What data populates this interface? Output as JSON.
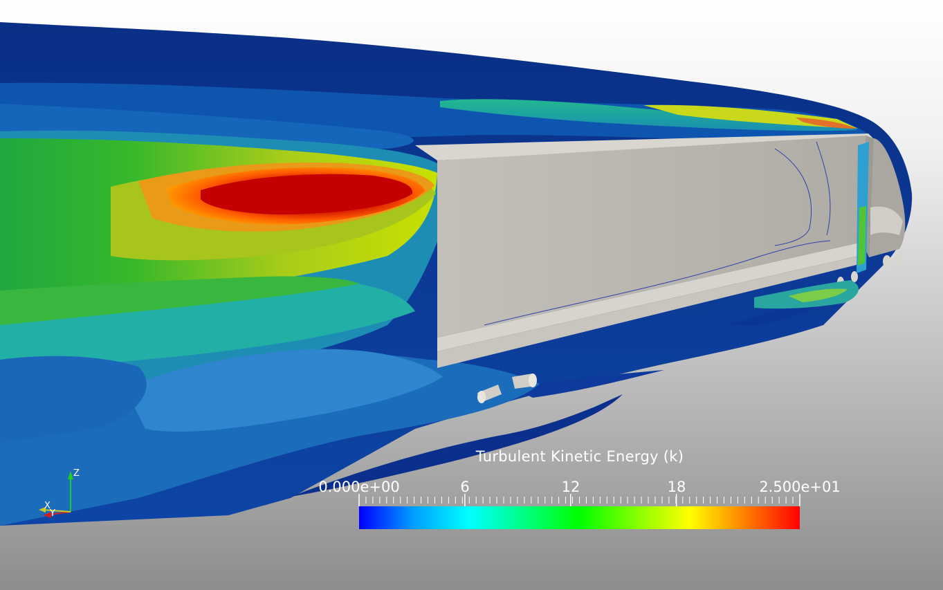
{
  "scalar_bar": {
    "title": "Turbulent Kinetic Energy (k)",
    "range": [
      0,
      25
    ],
    "labels": [
      "0.000e+00",
      "6",
      "12",
      "18",
      "2.500e+01"
    ],
    "label_values": [
      0,
      6,
      12,
      18,
      25
    ],
    "color_count": 64,
    "colormap": [
      "#0000ff",
      "#00a0ff",
      "#00ffff",
      "#00ff80",
      "#00ff00",
      "#80ff00",
      "#ffff00",
      "#ff8000",
      "#ff0000"
    ]
  },
  "orientation_axes": {
    "z": "Z",
    "x": "X",
    "y": "Y"
  },
  "colors": {
    "background_top": "#ffffff",
    "background_bottom": "#8f8f8f",
    "body_surface": "#b4b2aa",
    "low_k": "#003c9a",
    "mid_k": "#2f9fd4",
    "high_k": "#e00000"
  }
}
